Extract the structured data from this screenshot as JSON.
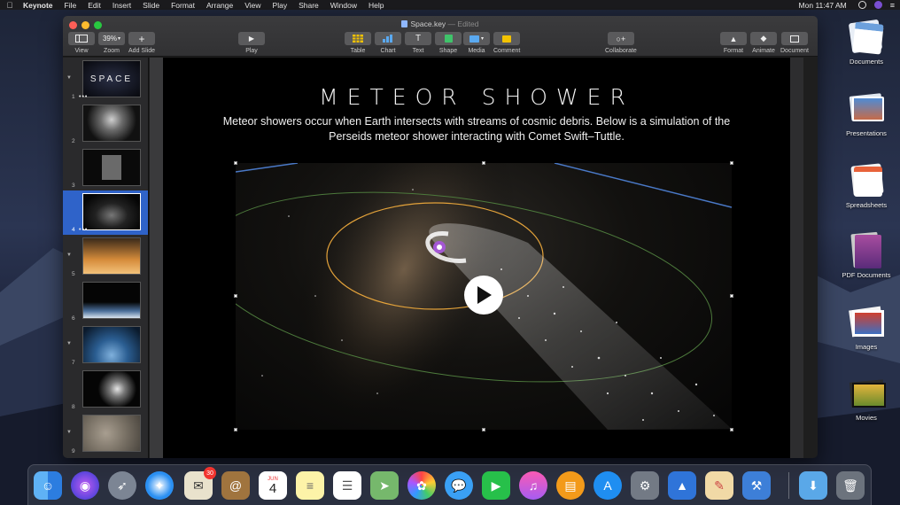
{
  "menubar": {
    "app": "Keynote",
    "items": [
      "File",
      "Edit",
      "Insert",
      "Slide",
      "Format",
      "Arrange",
      "View",
      "Play",
      "Share",
      "Window",
      "Help"
    ],
    "clock": "Mon 11:47 AM"
  },
  "window": {
    "title": "Space.key",
    "edited": " — Edited"
  },
  "toolbar": {
    "view_label": "View",
    "zoom_value": "39%",
    "zoom_label": "Zoom",
    "add_slide_label": "Add Slide",
    "play_label": "Play",
    "table_label": "Table",
    "chart_label": "Chart",
    "text_label": "Text",
    "shape_label": "Shape",
    "media_label": "Media",
    "comment_label": "Comment",
    "collaborate_label": "Collaborate",
    "format_label": "Format",
    "animate_label": "Animate",
    "document_label": "Document"
  },
  "slides": [
    {
      "number": "1",
      "thumb_text": "SPACE"
    },
    {
      "number": "2"
    },
    {
      "number": "3"
    },
    {
      "number": "4"
    },
    {
      "number": "5"
    },
    {
      "number": "6"
    },
    {
      "number": "7"
    },
    {
      "number": "8"
    },
    {
      "number": "9"
    }
  ],
  "slide": {
    "title": "METEOR SHOWER",
    "body": "Meteor showers occur when Earth intersects with streams of cosmic debris. Below is a simulation of the Perseids meteor shower interacting with Comet Swift–Tuttle."
  },
  "desktop_icons": [
    {
      "label": "Documents"
    },
    {
      "label": "Presentations"
    },
    {
      "label": "Spreadsheets"
    },
    {
      "label": "PDF Documents"
    },
    {
      "label": "Images"
    },
    {
      "label": "Movies"
    }
  ],
  "dock": {
    "mail_badge": "30",
    "calendar_month": "JUN",
    "calendar_day": "4"
  }
}
